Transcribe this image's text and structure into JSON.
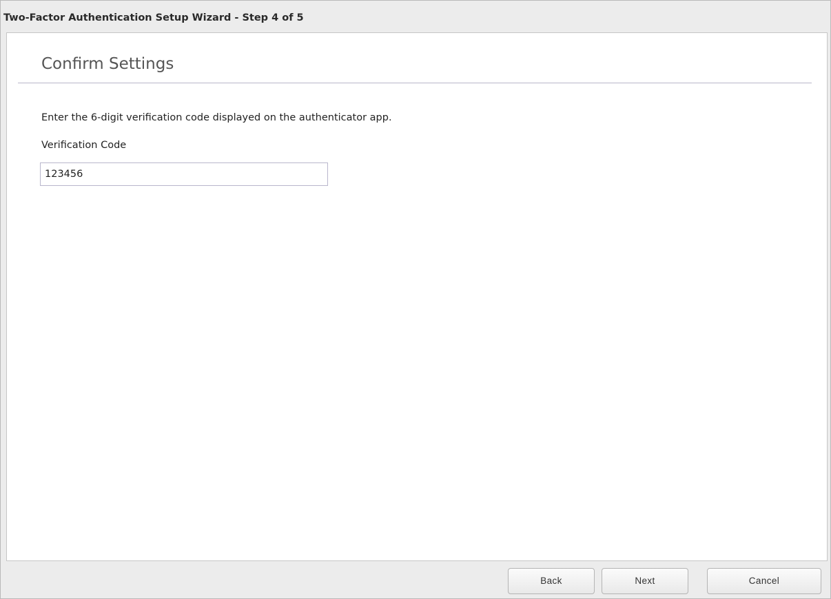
{
  "window": {
    "title": "Two-Factor Authentication Setup Wizard - Step 4 of 5"
  },
  "main": {
    "heading": "Confirm Settings",
    "instruction": "Enter the 6-digit verification code displayed on the authenticator app.",
    "verification_code": {
      "label": "Verification Code",
      "value": "123456"
    }
  },
  "footer": {
    "back_label": "Back",
    "next_label": "Next",
    "cancel_label": "Cancel"
  }
}
